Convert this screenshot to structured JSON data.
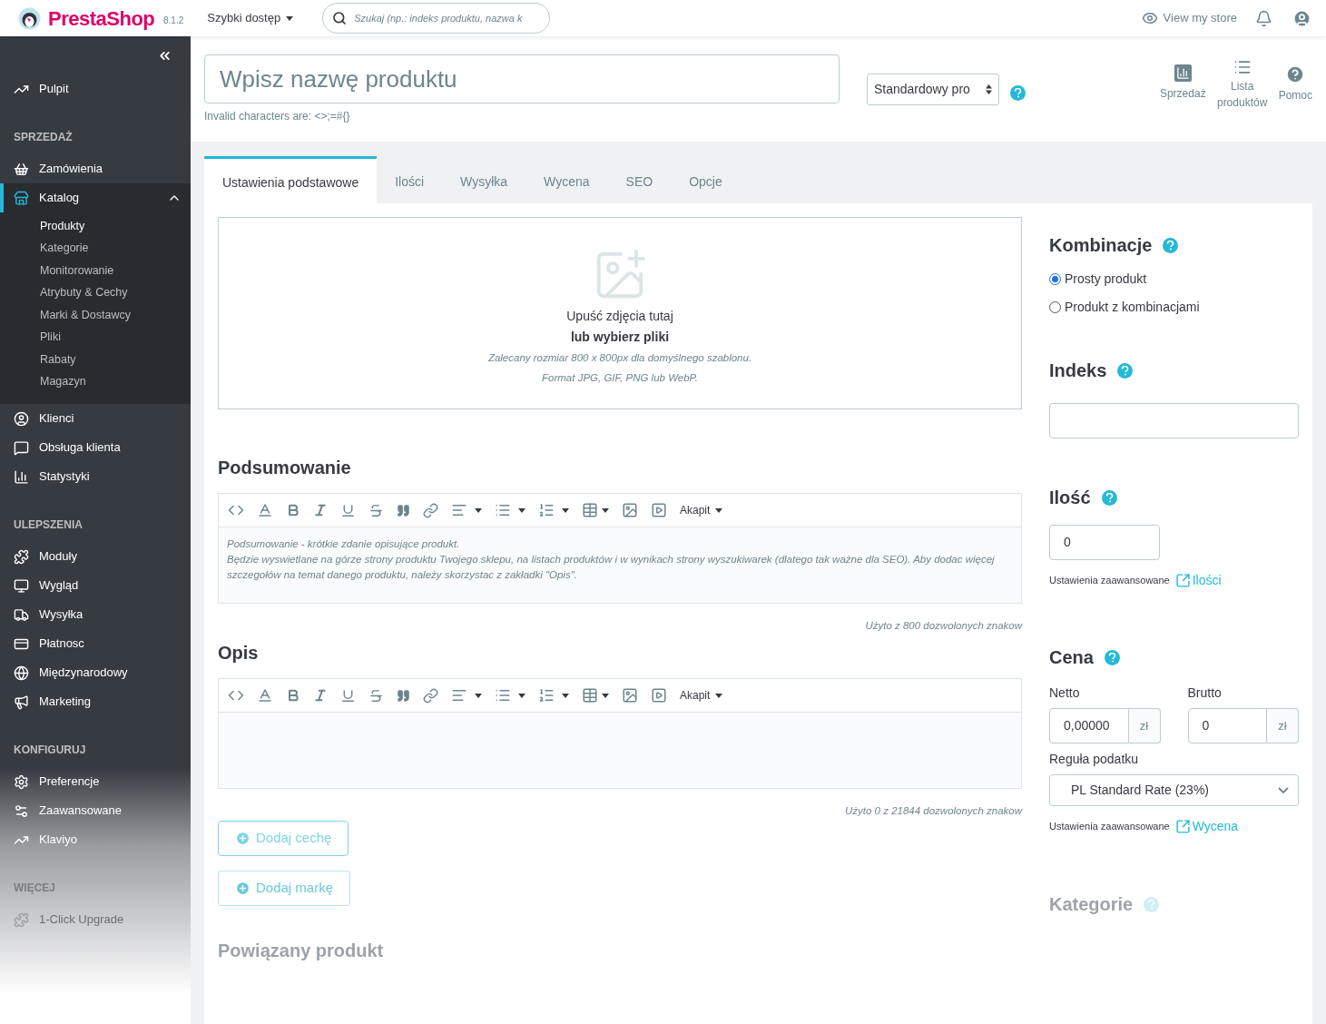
{
  "topbar": {
    "logo": "PrestaShop",
    "version": "8.1.2",
    "quick_access": "Szybki dostęp",
    "search": {
      "placeholder": "Szukaj (np.: indeks produktu, nazwa k"
    },
    "view_store": "View my store"
  },
  "sidebar": {
    "groups": [
      {
        "items": [
          {
            "label": "Pulpit",
            "selected": false
          }
        ]
      },
      {
        "title": "SPRZEDAŻ",
        "items": [
          {
            "label": "Zamówienia",
            "selected": false
          },
          {
            "label": "Katalog",
            "selected": true,
            "expanded": true,
            "children": [
              {
                "label": "Produkty",
                "selected": true
              },
              {
                "label": "Kategorie",
                "selected": false
              },
              {
                "label": "Monitorowanie",
                "selected": false
              },
              {
                "label": "Atrybuty & Cechy",
                "selected": false
              },
              {
                "label": "Marki & Dostawcy",
                "selected": false
              },
              {
                "label": "Pliki",
                "selected": false
              },
              {
                "label": "Rabaty",
                "selected": false
              },
              {
                "label": "Magazyn",
                "selected": false
              }
            ]
          },
          {
            "label": "Klienci",
            "selected": false
          },
          {
            "label": "Obsługa klienta",
            "selected": false
          },
          {
            "label": "Statystyki",
            "selected": false
          }
        ]
      },
      {
        "title": "ULEPSZENIA",
        "items": [
          {
            "label": "Moduły",
            "selected": false
          },
          {
            "label": "Wygląd",
            "selected": false
          },
          {
            "label": "Wysyłka",
            "selected": false
          },
          {
            "label": "Płatnosc",
            "selected": false
          },
          {
            "label": "Międzynarodowy",
            "selected": false
          },
          {
            "label": "Marketing",
            "selected": false
          }
        ]
      },
      {
        "title": "KONFIGURUJ",
        "items": [
          {
            "label": "Preferencje",
            "selected": false
          },
          {
            "label": "Zaawansowane",
            "selected": false
          },
          {
            "label": "Klaviyo",
            "selected": false
          }
        ]
      },
      {
        "title": "WIĘCEJ",
        "items": [
          {
            "label": "1-Click Upgrade",
            "selected": false
          }
        ]
      }
    ]
  },
  "header": {
    "name": {
      "placeholder": "Wpisz nazwę produktu"
    },
    "hint": "Invalid characters are: <>;=#{}",
    "type_select": "Standardowy pro",
    "toolbar": [
      "Sprzedaż",
      "Lista produktów",
      "Pomoc"
    ]
  },
  "tabs": [
    {
      "label": "Ustawienia podstawowe",
      "selected": true
    },
    {
      "label": "Ilości",
      "selected": false
    },
    {
      "label": "Wysyłka",
      "selected": false
    },
    {
      "label": "Wycena",
      "selected": false
    },
    {
      "label": "SEO",
      "selected": false
    },
    {
      "label": "Opcje",
      "selected": false
    }
  ],
  "dropzone": {
    "line1": "Upuść zdjęcia tutaj",
    "line2": "lub wybierz pliki",
    "line3": "Zalecany rozmiar 800 x 800px dla domyślnego szablonu.",
    "line4": "Format JPG, GIF, PNG lub WebP."
  },
  "summary": {
    "title": "Podsumowanie",
    "format": "Akapit",
    "text": [
      "Podsumowanie - krótkie zdanie opisujące produkt.",
      "Będzie wyswietlane na górze strony produktu Twojego sklepu, na listach produktów i w wynikach strony wyszukiwarek (dlatego tak ważne dla SEO). Aby dodac więcej szczegołów na temat danego produktu, należy skorzystac z zakładki \"Opis\"."
    ],
    "counter": "Użyto z 800 dozwolonych znakow"
  },
  "description": {
    "title": "Opis",
    "format": "Akapit",
    "counter": "Użyto 0 z 21844 dozwolonych znakow"
  },
  "buttons": [
    "Dodaj cechę",
    "Dodaj markę"
  ],
  "related": {
    "title": "Powiązany produkt"
  },
  "combinations": {
    "title": "Kombinacje",
    "options": [
      {
        "label": "Prosty produkt",
        "selected": true
      },
      {
        "label": "Produkt z kombinacjami",
        "selected": false
      }
    ]
  },
  "reference": {
    "title": "Indeks"
  },
  "quantity": {
    "title": "Ilość",
    "value": "0",
    "advanced": "Ustawienia zaawansowane",
    "link": "Ilości"
  },
  "price": {
    "title": "Cena",
    "net_label": "Netto",
    "net": "0,00000",
    "gross_label": "Brutto",
    "gross": "0",
    "net_currency": "zł",
    "gross_currency": "zł",
    "tax_label": "Reguła podatku",
    "tax": "PL Standard Rate (23%)",
    "advanced": "Ustawienia zaawansowane",
    "link": "Wycena"
  },
  "categories": {
    "title": "Kategorie"
  }
}
